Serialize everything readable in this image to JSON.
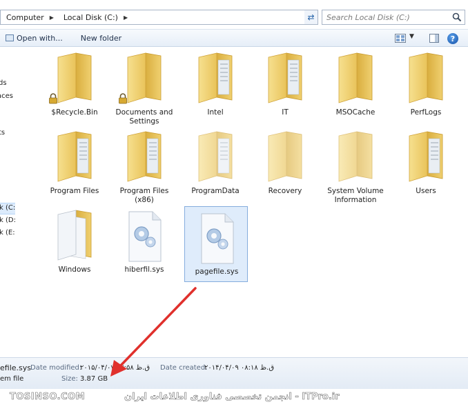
{
  "address_bar": {
    "crumbs": [
      "Computer",
      "Local Disk (C:)"
    ]
  },
  "search": {
    "placeholder": "Search Local Disk (C:)"
  },
  "toolbar": {
    "open_with_label": "Open with...",
    "new_folder_label": "New folder"
  },
  "nav": {
    "items": [
      "ds",
      "aces",
      "ts",
      "k (C:)",
      "k (D:)",
      "k (E:)"
    ]
  },
  "files": [
    {
      "label": "$Recycle.Bin",
      "icon": "locked-folder-icon"
    },
    {
      "label": "Documents and Settings",
      "icon": "locked-folder-icon"
    },
    {
      "label": "Intel",
      "icon": "folder-icon"
    },
    {
      "label": "IT",
      "icon": "folder-icon"
    },
    {
      "label": "MSOCache",
      "icon": "folder-icon"
    },
    {
      "label": "PerfLogs",
      "icon": "folder-icon"
    },
    {
      "label": "Program Files",
      "icon": "folder-icon"
    },
    {
      "label": "Program Files (x86)",
      "icon": "folder-icon"
    },
    {
      "label": "ProgramData",
      "icon": "folder-icon"
    },
    {
      "label": "Recovery",
      "icon": "folder-icon"
    },
    {
      "label": "System Volume Information",
      "icon": "folder-icon"
    },
    {
      "label": "Users",
      "icon": "folder-icon"
    },
    {
      "label": "Windows",
      "icon": "folder-icon"
    },
    {
      "label": "hiberfil.sys",
      "icon": "system-file-icon"
    },
    {
      "label": "pagefile.sys",
      "icon": "system-file-icon",
      "selected": true
    }
  ],
  "details": {
    "name": "efile.sys",
    "type": "em file",
    "date_modified_label": "Date modified:",
    "date_modified_value": "۲۰۱۵/۰۴/۰۷ ق.ظ ۰۷:۵۸",
    "date_created_label": "Date created:",
    "date_created_value": "۲۰۱۴/۰۴/۰۹ ق.ظ ۰۸:۱۸",
    "size_label": "Size:",
    "size_value": "3.87 GB"
  },
  "watermark": {
    "left": "TOSINSO.COM",
    "right": "انجمن تخصصی فناوری اطلاعات ایران - ITPro.ir"
  },
  "colors": {
    "folder_body": "#f2d67a",
    "folder_back": "#e2b94a",
    "selection": "#dfecfb",
    "arrow": "#e0302c"
  }
}
